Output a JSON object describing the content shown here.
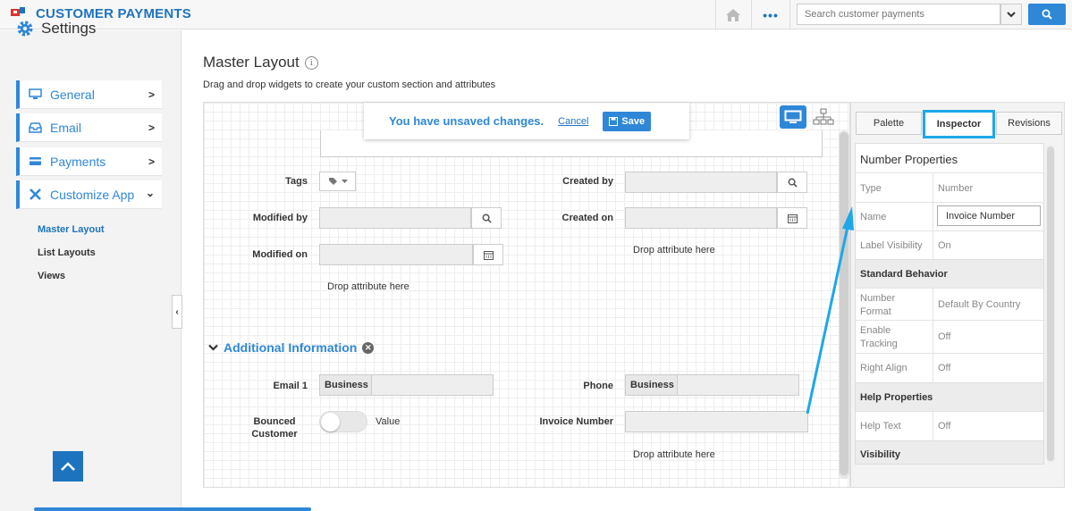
{
  "app": {
    "title": "CUSTOMER PAYMENTS"
  },
  "topbar": {
    "more": "•••",
    "search_placeholder": "Search customer payments"
  },
  "sidebar": {
    "heading": "Settings",
    "items": [
      {
        "label": "General",
        "icon": "monitor-icon"
      },
      {
        "label": "Email",
        "icon": "inbox-icon"
      },
      {
        "label": "Payments",
        "icon": "card-icon"
      },
      {
        "label": "Customize App",
        "icon": "tools-icon"
      }
    ],
    "sub_items": [
      "Master Layout",
      "List Layouts",
      "Views"
    ]
  },
  "main": {
    "title": "Master Layout",
    "subtitle": "Drag and drop widgets to create your custom section and attributes",
    "unsaved": {
      "text": "You have unsaved changes.",
      "cancel": "Cancel",
      "save": "Save"
    },
    "fields": {
      "tags": "Tags",
      "created_by": "Created by",
      "modified_by": "Modified by",
      "created_on": "Created on",
      "modified_on": "Modified on",
      "drop": "Drop attribute here"
    },
    "section": {
      "title": "Additional Information",
      "email": "Email 1",
      "email_type": "Business",
      "phone": "Phone",
      "phone_type": "Business",
      "bounced_1": "Bounced",
      "bounced_2": "Customer",
      "toggle_value": "Value",
      "invoice": "Invoice Number",
      "drop": "Drop attribute here"
    }
  },
  "panel": {
    "tabs": [
      "Palette",
      "Inspector",
      "Revisions"
    ],
    "title": "Number Properties",
    "rows": {
      "type_k": "Type",
      "type_v": "Number",
      "name_k": "Name",
      "name_v": "Invoice Number",
      "label_k": "Label Visibility",
      "label_v": "On",
      "std_head": "Standard Behavior",
      "fmt_k1": "Number",
      "fmt_k2": "Format",
      "fmt_v": "Default By Country",
      "track_k1": "Enable",
      "track_k2": "Tracking",
      "track_v": "Off",
      "align_k": "Right Align",
      "align_v": "Off",
      "help_head": "Help Properties",
      "help_k": "Help Text",
      "help_v": "Off",
      "vis_head": "Visibility"
    }
  },
  "colors": {
    "accent": "#2f87d8",
    "highlight": "#1da8e8"
  }
}
